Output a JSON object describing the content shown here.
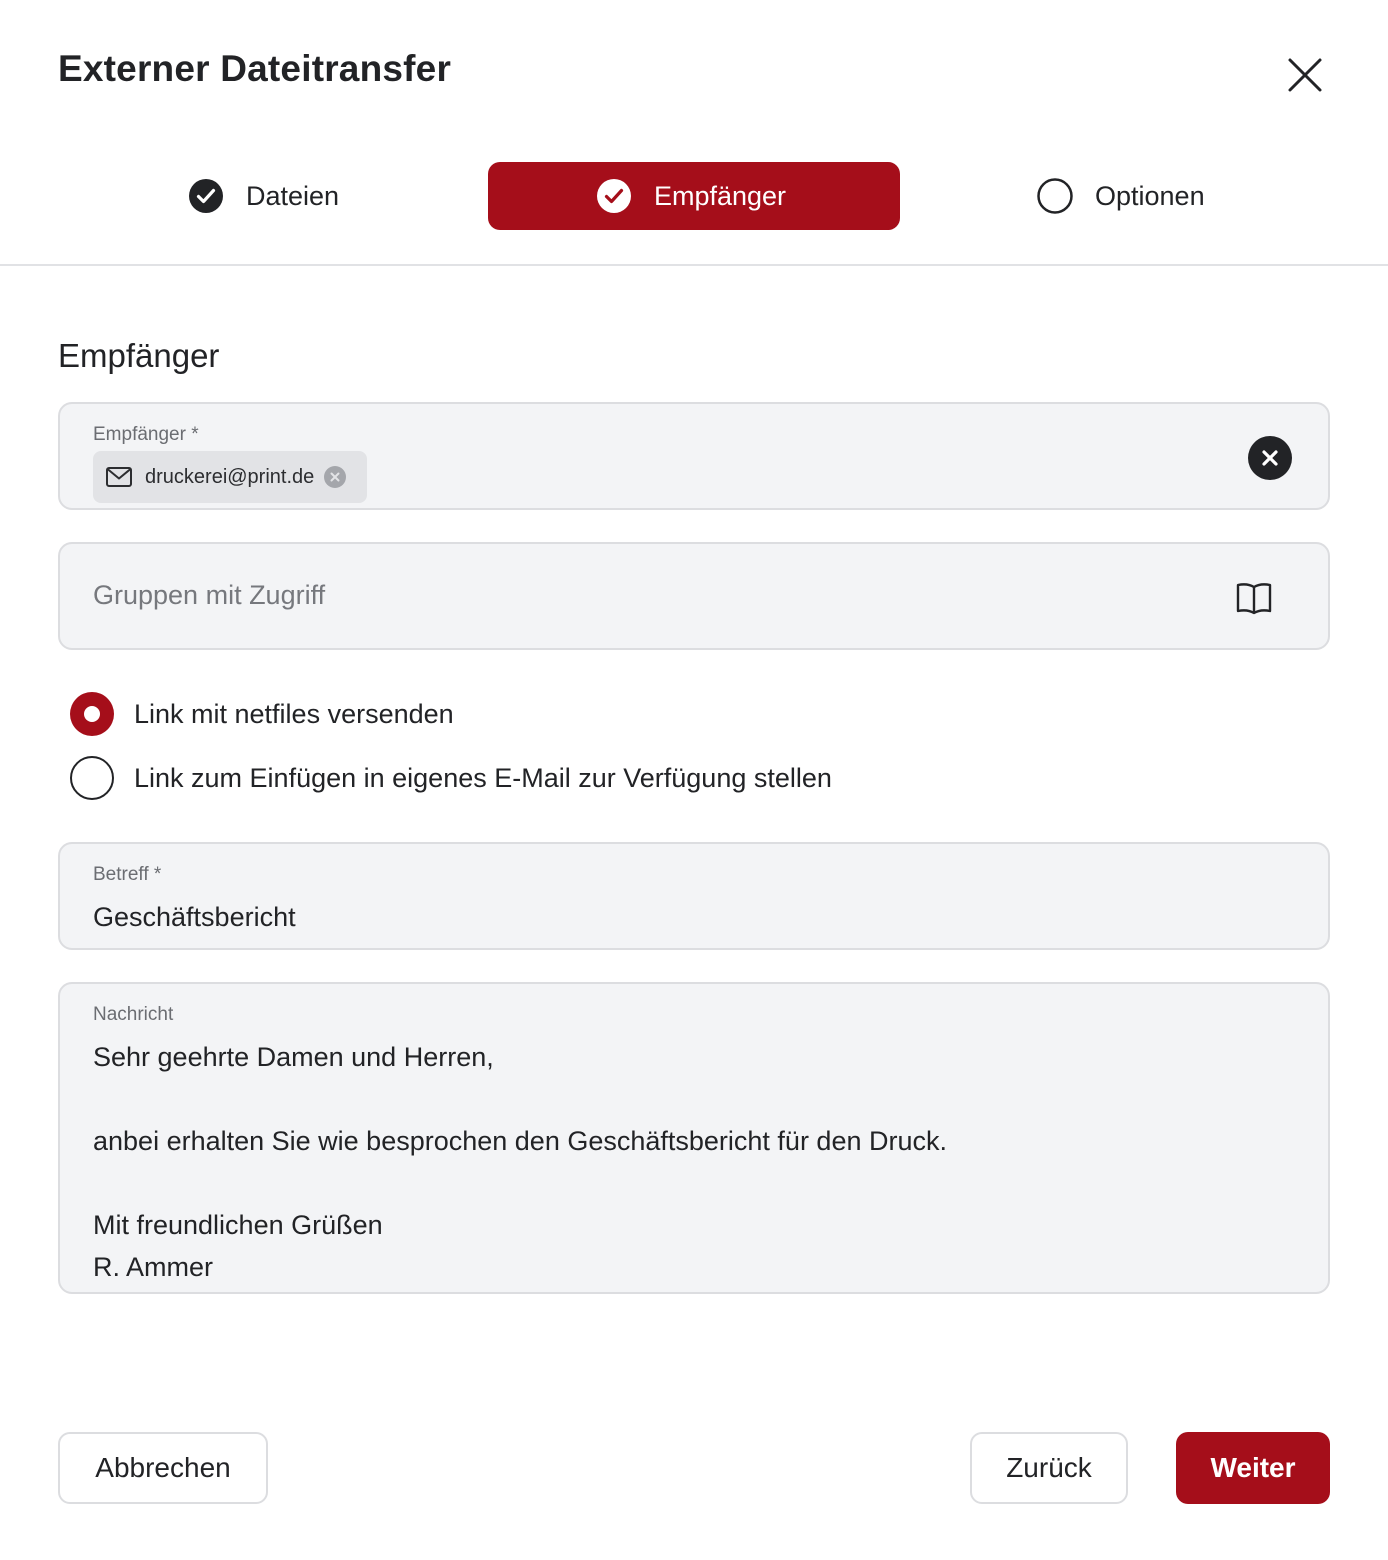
{
  "dialog": {
    "title": "Externer Dateitransfer"
  },
  "stepper": {
    "steps": [
      {
        "label": "Dateien",
        "state": "completed"
      },
      {
        "label": "Empfänger",
        "state": "active"
      },
      {
        "label": "Optionen",
        "state": "pending"
      }
    ]
  },
  "section": {
    "title": "Empfänger"
  },
  "recipient_field": {
    "label": "Empfänger *",
    "chips": [
      {
        "value": "druckerei@print.de",
        "icon": "mail-icon"
      }
    ]
  },
  "groups_field": {
    "placeholder": "Gruppen mit Zugriff",
    "icon": "book-icon"
  },
  "send_mode": {
    "options": [
      {
        "label": "Link mit netfiles versenden",
        "selected": true
      },
      {
        "label": "Link zum Einfügen in eigenes E-Mail zur Verfügung stellen",
        "selected": false
      }
    ]
  },
  "subject_field": {
    "label": "Betreff *",
    "value": "Geschäftsbericht"
  },
  "message_field": {
    "label": "Nachricht",
    "lines": [
      "Sehr geehrte Damen und Herren,",
      "",
      "anbei erhalten Sie wie besprochen den Geschäftsbericht für den Druck.",
      "",
      "Mit freundlichen Grüßen",
      "R. Ammer"
    ]
  },
  "footer": {
    "cancel_label": "Abbrechen",
    "back_label": "Zurück",
    "next_label": "Weiter"
  },
  "colors": {
    "accent": "#a50e1a",
    "text": "#222326",
    "field_bg": "#f3f4f6"
  }
}
